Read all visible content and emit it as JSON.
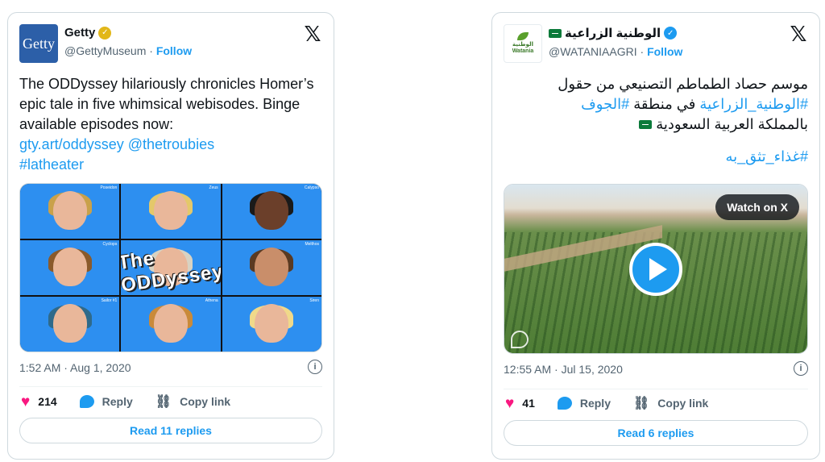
{
  "tweet1": {
    "display_name": "Getty",
    "handle": "@GettyMuseum",
    "separator": "·",
    "follow_label": "Follow",
    "avatar_text": "Getty",
    "text_plain": "The ODDyssey hilariously chronicles Homer’s epic tale in five whimsical webisodes. Binge available episodes now:",
    "link_url": "gty.art/oddyssey",
    "mention": "@thetroubies",
    "hashtag": "#latheater",
    "media_overlay_title": "The ODDyssey",
    "timestamp": "1:52 AM · Aug 1, 2020",
    "likes": "214",
    "reply_label": "Reply",
    "copy_link_label": "Copy link",
    "read_replies_label": "Read 11 replies",
    "grid_labels": [
      "Poseidon",
      "Zeus",
      "Calypso",
      "Cyclops",
      "",
      "Melthos",
      "Sailor #1",
      "Athena",
      "Siren"
    ]
  },
  "tweet2": {
    "display_name": "الوطنية الزراعية",
    "handle": "@WATANIAAGRI",
    "separator": "·",
    "follow_label": "Follow",
    "avatar_text_ar": "الوطنية",
    "avatar_text_en": "Watania",
    "text_line1": "موسم حصاد الطماطم التصنيعي من حقول",
    "hashtag_watania": "#الوطنية_الزراعية",
    "text_in_region": "في منطقة",
    "hashtag_jouf": "#الجوف",
    "text_line3": "بالمملكة العربية السعودية",
    "hashtag_food": "#غذاء_تثق_به",
    "watch_label": "Watch on X",
    "timestamp": "12:55 AM · Jul 15, 2020",
    "likes": "41",
    "reply_label": "Reply",
    "copy_link_label": "Copy link",
    "read_replies_label": "Read 6 replies"
  },
  "icons": {
    "x_logo": "𝕏",
    "info": "i",
    "heart": "♥",
    "link": "🔗",
    "verified": "✓"
  },
  "colors": {
    "accent": "#1d9bf0",
    "like": "#f91880",
    "muted": "#536471",
    "border": "#cfd9de",
    "gold_badge": "#e2b719"
  }
}
